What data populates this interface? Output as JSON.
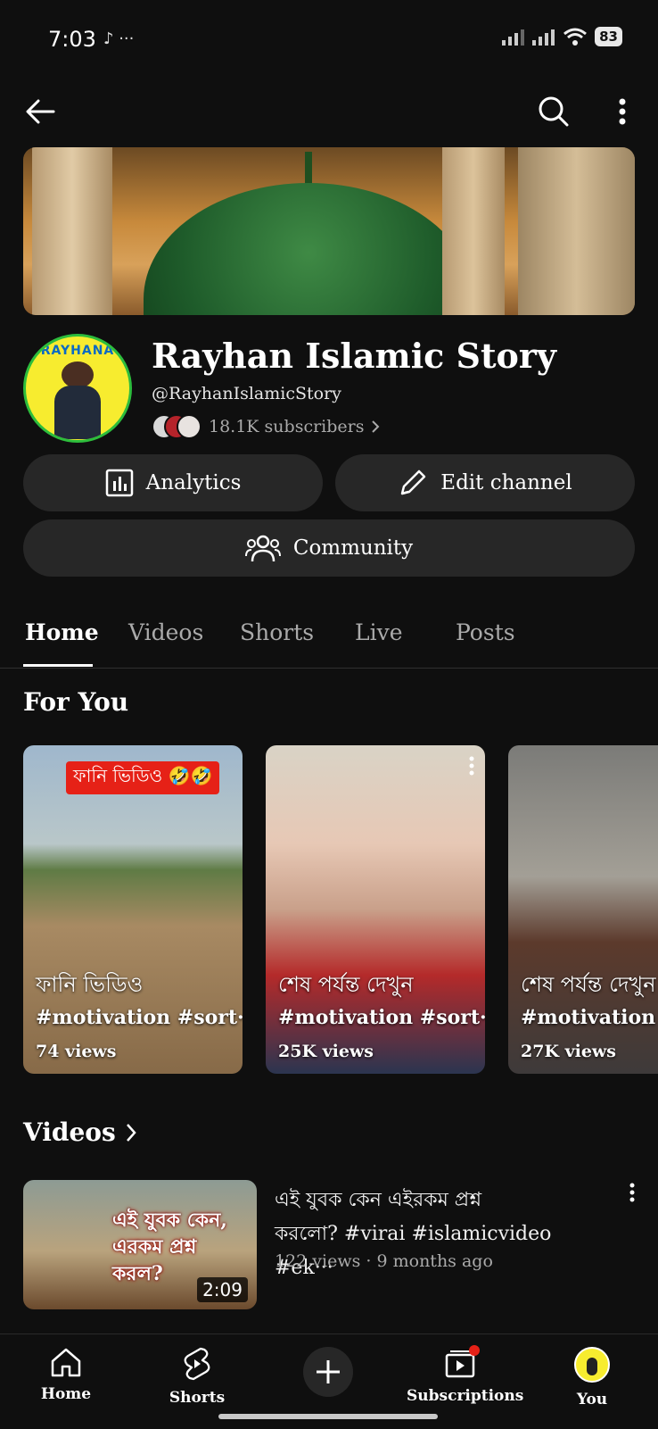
{
  "status": {
    "time": "7:03",
    "icons": "♪ ···",
    "battery": "83"
  },
  "channel": {
    "name": "Rayhan Islamic Story",
    "handle": "@RayhanIslamicStory",
    "subscribers": "18.1K subscribers",
    "avatar_text": "RAYHANA"
  },
  "buttons": {
    "analytics": "Analytics",
    "edit": "Edit channel",
    "community": "Community"
  },
  "tabs": [
    "Home",
    "Videos",
    "Shorts",
    "Live",
    "Posts"
  ],
  "sections": {
    "for_you": "For You",
    "videos": "Videos"
  },
  "shorts": [
    {
      "badge": "ফানি ভিডিও 🤣🤣",
      "title": "ফানি ভিডিও",
      "tags": "#motivation #sort···",
      "views": "74 views"
    },
    {
      "title": "শেষ পর্যন্ত দেখুন",
      "tags": "#motivation #sort···",
      "views": "25K views"
    },
    {
      "title": "শেষ পর্যন্ত দেখুন",
      "tags": "#motivation #",
      "views": "27K views"
    }
  ],
  "video": {
    "title_line1": "এই যুবক কেন এইরকম প্রশ্ন",
    "title_line2": "করলো? #virai #islamicvideo #ek···",
    "meta": "122 views · 9 months ago",
    "duration": "2:09",
    "thumb_text_1": "এই যুবক কেন,",
    "thumb_text_2": "এরকম প্রশ্ন",
    "thumb_text_3": "করল?"
  },
  "nav": {
    "home": "Home",
    "shorts": "Shorts",
    "subscriptions": "Subscriptions",
    "you": "You"
  },
  "colors": {
    "bg": "#0f0f0f",
    "pill": "#272727",
    "badge_red": "#e62117"
  }
}
